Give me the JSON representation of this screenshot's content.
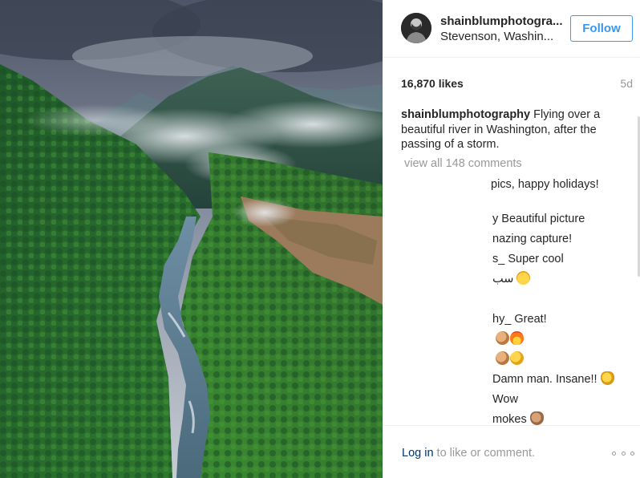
{
  "photo": {
    "subject": "aerial view of a forested river valley with misty mountains under storm clouds"
  },
  "header": {
    "username": "shainblumphotogra...",
    "location": "Stevenson, Washin...",
    "follow_label": "Follow"
  },
  "stats": {
    "likes": "16,870 likes",
    "time_ago": "5d"
  },
  "caption": {
    "author": "shainblumphotography",
    "text": " Flying over a beautiful river in Washington, after the passing of a storm."
  },
  "view_all_comments": "view all 148 comments",
  "comments": [
    {
      "text": "pics, happy holidays!",
      "emoji": []
    },
    {
      "text": "y Beautiful picture",
      "emoji": []
    },
    {
      "text": "nazing capture!",
      "emoji": []
    },
    {
      "text": "s_ Super cool",
      "emoji": []
    },
    {
      "text": "سب",
      "emoji": [
        "heart-eyes"
      ]
    },
    {
      "text": "hy_ Great!",
      "emoji": []
    },
    {
      "text": "",
      "emoji": [
        "clap",
        "fire"
      ]
    },
    {
      "text": "",
      "emoji": [
        "clap",
        "clapy"
      ]
    },
    {
      "text": "Damn man. Insane!!",
      "emoji": [
        "ok"
      ]
    },
    {
      "text": "Wow",
      "emoji": []
    },
    {
      "text": "mokes",
      "emoji": [
        "hand"
      ]
    }
  ],
  "footer": {
    "login_link": "Log in",
    "login_rest": " to like or comment.",
    "more_icon": "ellipsis-icon"
  },
  "colors": {
    "accent": "#3897f0",
    "link": "#003569",
    "muted": "#999999",
    "text": "#262626"
  }
}
